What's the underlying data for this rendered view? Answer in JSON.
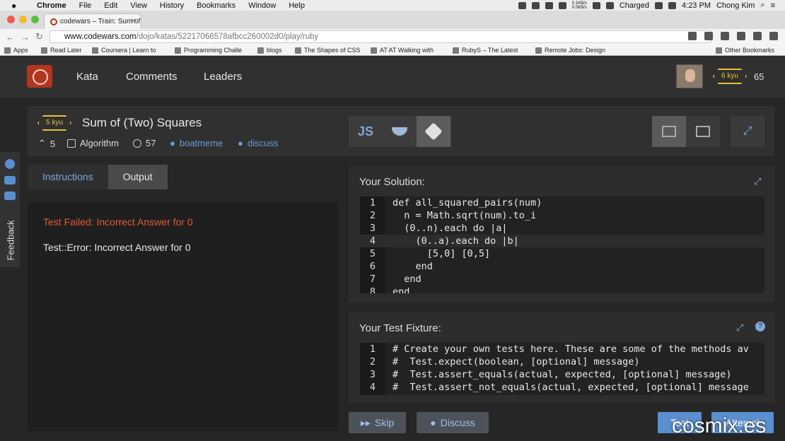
{
  "menubar": {
    "app": "Chrome",
    "items": [
      "File",
      "Edit",
      "View",
      "History",
      "Bookmarks",
      "Window",
      "Help"
    ],
    "net_up": "0.1KB/s",
    "net_down": "0.0KB/s",
    "battery": "Charged",
    "time": "4:23 PM",
    "user": "Chong Kim"
  },
  "browser": {
    "tab_title": "codewars – Train: Sum of",
    "url_host": "www.codewars.com",
    "url_path": "/dojo/katas/52217066578afbcc260002d0/play/ruby",
    "bookmarks": [
      "Apps",
      "Read Later",
      "Coursera | Learn to",
      "Programming Challe",
      "blogs",
      "The Shapes of CSS",
      "AT AT Walking with",
      "RubyS – The Latest",
      "Remote Jobs: Design"
    ],
    "other_bookmarks": "Other Bookmarks"
  },
  "header": {
    "nav": [
      "Kata",
      "Comments",
      "Leaders"
    ],
    "rank": "6 kyu",
    "honor": "65"
  },
  "kata": {
    "rank": "5 kyu",
    "title": "Sum of (Two) Squares",
    "votes": "5",
    "category": "Algorithm",
    "completions": "57",
    "author": "boatmeme",
    "discuss": "discuss",
    "languages": [
      "JS",
      "coffee-icon",
      "ruby-icon"
    ]
  },
  "sidebar": {
    "feedback": "Feedback"
  },
  "left_panel": {
    "tabs": [
      "Instructions",
      "Output"
    ],
    "active_tab": "Output",
    "fail_message": "Test Failed: Incorrect Answer for 0",
    "error_message": "Test::Error: Incorrect Answer for 0"
  },
  "solution": {
    "heading": "Your Solution:",
    "lines": [
      {
        "n": "1",
        "t": "def all_squared_pairs(num)"
      },
      {
        "n": "2",
        "t": "  n = Math.sqrt(num).to_i"
      },
      {
        "n": "3",
        "t": "  (0..n).each do |a|"
      },
      {
        "n": "4",
        "t": "    (0..a).each do |b|"
      },
      {
        "n": "5",
        "t": "      [5,0] [0,5]"
      },
      {
        "n": "6",
        "t": "    end"
      },
      {
        "n": "7",
        "t": "  end"
      },
      {
        "n": "8",
        "t": "end"
      }
    ]
  },
  "fixture": {
    "heading": "Your Test Fixture:",
    "lines": [
      {
        "n": "1",
        "t": "# Create your own tests here. These are some of the methods av"
      },
      {
        "n": "2",
        "t": "#  Test.expect(boolean, [optional] message)"
      },
      {
        "n": "3",
        "t": "#  Test.assert_equals(actual, expected, [optional] message)"
      },
      {
        "n": "4",
        "t": "#  Test.assert_not_equals(actual, expected, [optional] message"
      }
    ]
  },
  "buttons": {
    "skip": "Skip",
    "discuss": "Discuss",
    "test": "Test",
    "attempt": "Attempt"
  },
  "watermark": "cosmix.es",
  "colors": {
    "accent": "#b1361e",
    "kyu": "#e6c23a",
    "link": "#7fa7d8",
    "error": "#e05a3a"
  }
}
